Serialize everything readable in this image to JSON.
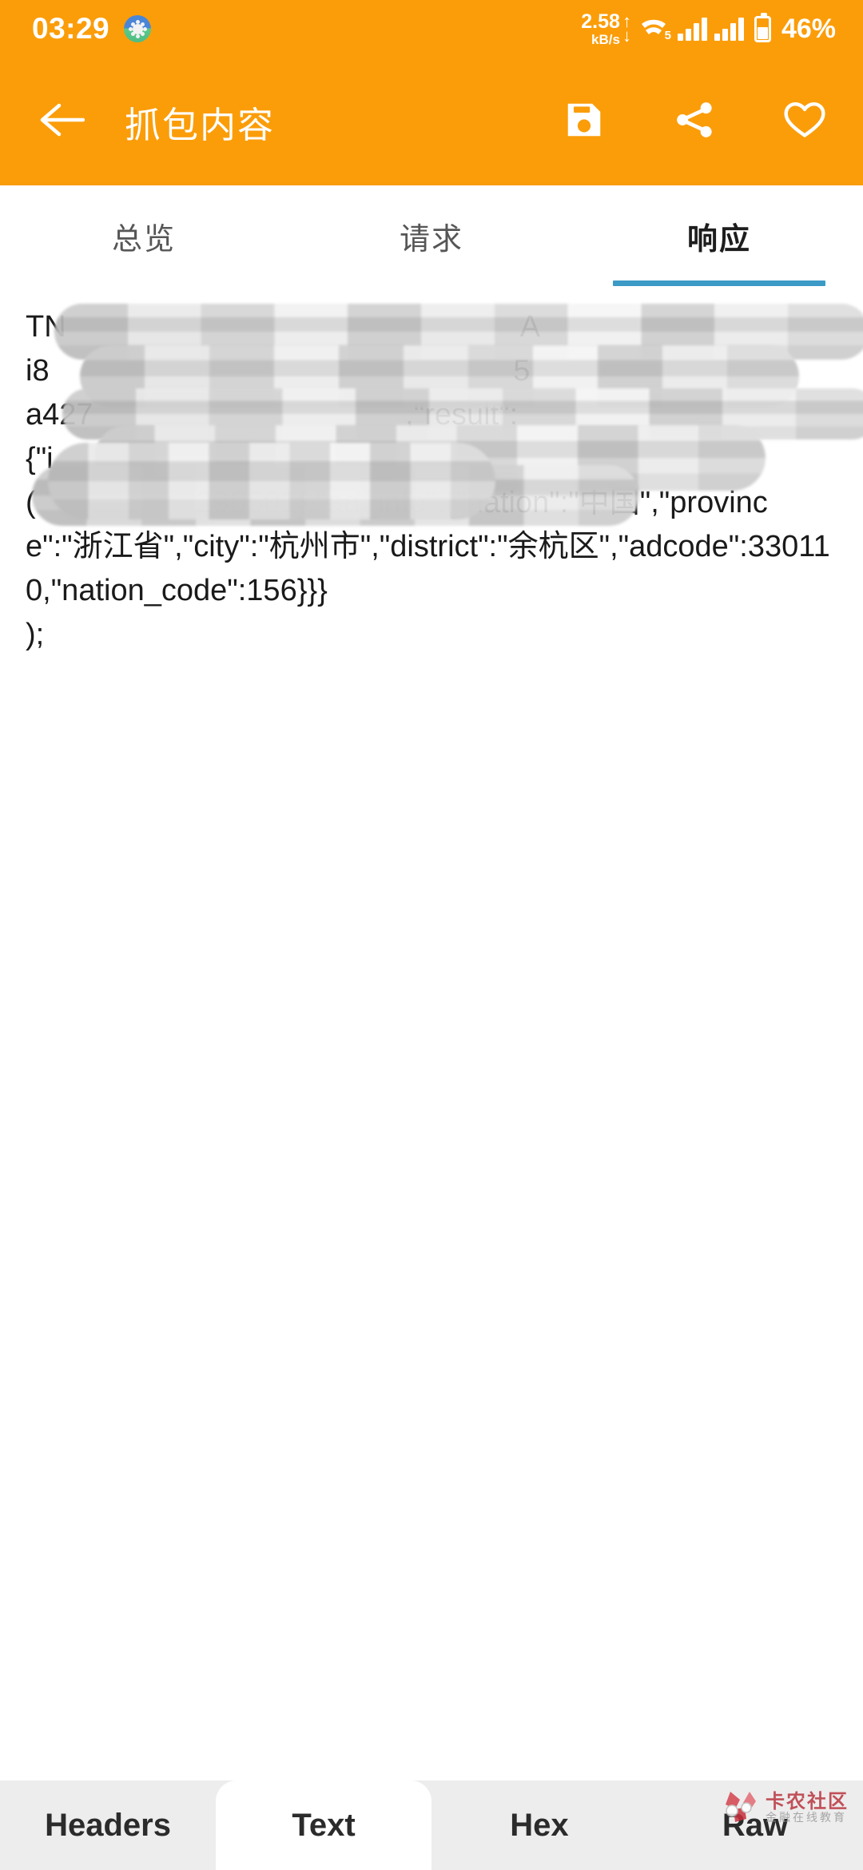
{
  "status_bar": {
    "clock": "03:29",
    "app_icon": "android-app-icon",
    "net_speed_value": "2.58",
    "net_speed_unit": "kB/s",
    "upload_arrow": "↑",
    "download_arrow": "↓",
    "wifi_icon": "wifi-icon",
    "network_generation": "5",
    "signal_icon_1": "signal-bars-icon",
    "signal_icon_2": "signal-bars-icon",
    "battery_icon": "battery-icon",
    "battery_percent": "46%"
  },
  "app_bar": {
    "back_icon": "back-arrow-icon",
    "title": "抓包内容",
    "save_icon": "save-floppy-icon",
    "share_icon": "share-icon",
    "favorite_icon": "heart-icon",
    "background_color": "#FB9D09"
  },
  "tabs": {
    "items": [
      {
        "label": "总览",
        "active": false
      },
      {
        "label": "请求",
        "active": false
      },
      {
        "label": "响应",
        "active": true
      }
    ],
    "indicator_color": "#3C9BC6"
  },
  "response_body": {
    "line_1_visible_prefix": "TN",
    "line_1_visible_suffix": "A",
    "line_2_visible_prefix": "i8",
    "line_2_visible_suffix": "5",
    "line_3_visible_prefix": "a427",
    "line_3_visible_suffix": "\"result\":",
    "line_4_visible_prefix": "{\"i",
    "line_5_visible_prefix": "(",
    "text": "TN                                                      A\ni8                                                       5\na427                                     ,\"result\":\n{\"i                                   .\n(                   298501},\"ad_info\":{\"nation\":\"中国\",\"province\":\"浙江省\",\"city\":\"杭州市\",\"district\":\"余杭区\",\"adcode\":330110,\"nation_code\":156}}}\n);",
    "visible_tail": "298501},\"ad_info\":{\"nation\":\"中国\",\"province\":\"浙江省\",\"city\":\"杭州市\",\"district\":\"余杭区\",\"adcode\":330110,\"nation_code\":156}}}\n);",
    "redaction": "mosaic-blur-overlay"
  },
  "bottom_tabs": {
    "items": [
      {
        "label": "Headers",
        "active": false
      },
      {
        "label": "Text",
        "active": true
      },
      {
        "label": "Hex",
        "active": false
      },
      {
        "label": "Raw",
        "active": false
      }
    ]
  },
  "watermark": {
    "title": "卡农社区",
    "subtitle": "金融在线教育",
    "logo_icon": "flower-logo-icon",
    "title_color": "#b9353f"
  }
}
